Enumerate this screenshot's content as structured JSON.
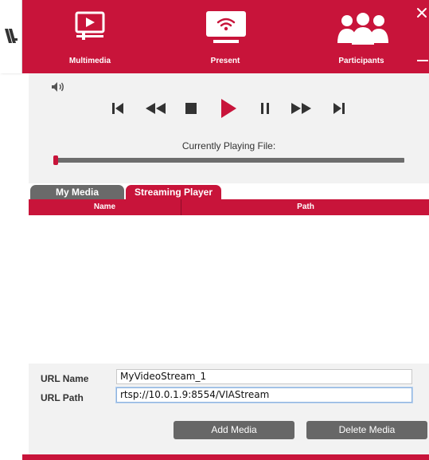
{
  "header": {
    "nav": [
      {
        "label": "Multimedia",
        "icon": "multimedia-icon"
      },
      {
        "label": "Present",
        "icon": "present-icon"
      },
      {
        "label": "Participants",
        "icon": "participants-icon"
      }
    ],
    "close_icon": "close-icon",
    "minimize_icon": "minimize-icon"
  },
  "logo": "via-logo",
  "player": {
    "controls": [
      "skip-to-start-icon",
      "rewind-icon",
      "stop-icon",
      "play-icon",
      "pause-icon",
      "fast-forward-icon",
      "skip-to-end-icon"
    ],
    "volume_icon": "volume-icon",
    "currently_playing_label": "Currently Playing File:",
    "progress": 0.0
  },
  "tabs": [
    {
      "label": "My Media",
      "active": false
    },
    {
      "label": "Streaming Player",
      "active": true
    }
  ],
  "table": {
    "columns": [
      "Name",
      "Path"
    ],
    "rows": []
  },
  "form": {
    "url_name_label": "URL Name",
    "url_name_value": "MyVideoStream_1",
    "url_path_label": "URL Path",
    "url_path_value": "rtsp://10.0.1.9:8554/VIAStream"
  },
  "buttons": {
    "add_media": "Add Media",
    "delete_media": "Delete Media"
  },
  "colors": {
    "brand_red": "#c8143a",
    "button_gray": "#676767",
    "panel_gray": "#f2f2f2"
  }
}
